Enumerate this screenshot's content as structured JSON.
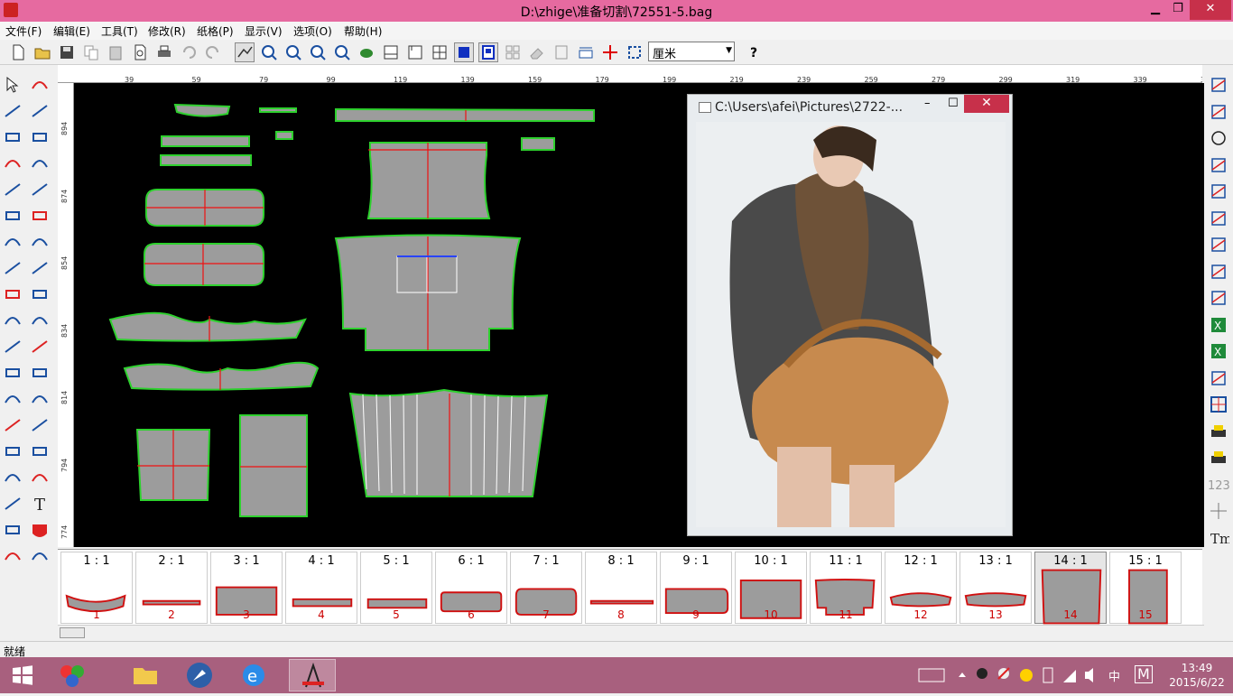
{
  "window": {
    "title": "D:\\zhige\\准备切割\\72551-5.bag",
    "min": "▁",
    "max": "❐",
    "close": "✕"
  },
  "menu": [
    "文件(F)",
    "编辑(E)",
    "工具(T)",
    "修改(R)",
    "纸格(P)",
    "显示(V)",
    "选项(O)",
    "帮助(H)"
  ],
  "toolbar": {
    "unit_value": "厘米"
  },
  "ruler": {
    "h_ticks": [
      "39",
      "59",
      "79",
      "99",
      "119",
      "139",
      "159",
      "179",
      "199",
      "219",
      "239",
      "259",
      "279",
      "299",
      "319",
      "339",
      "35"
    ],
    "v_ticks": [
      "894",
      "874",
      "854",
      "834",
      "814",
      "794",
      "774"
    ]
  },
  "photo_window": {
    "title": "C:\\Users\\afei\\Pictures\\2722-...",
    "min": "–",
    "max": "☐",
    "close": "✕"
  },
  "thumbnails": [
    {
      "scale": "1 : 1",
      "name": "1"
    },
    {
      "scale": "2 : 1",
      "name": "2"
    },
    {
      "scale": "3 : 1",
      "name": "3"
    },
    {
      "scale": "4 : 1",
      "name": "4"
    },
    {
      "scale": "5 : 1",
      "name": "5"
    },
    {
      "scale": "6 : 1",
      "name": "6"
    },
    {
      "scale": "7 : 1",
      "name": "7"
    },
    {
      "scale": "8 : 1",
      "name": "8"
    },
    {
      "scale": "9 : 1",
      "name": "9"
    },
    {
      "scale": "10 : 1",
      "name": "10"
    },
    {
      "scale": "11 : 1",
      "name": "11"
    },
    {
      "scale": "12 : 1",
      "name": "12"
    },
    {
      "scale": "13 : 1",
      "name": "13"
    },
    {
      "scale": "14 : 1",
      "name": "14"
    },
    {
      "scale": "15 : 1",
      "name": "15"
    }
  ],
  "status": {
    "text": "就绪"
  },
  "taskbar": {
    "time": "13:49",
    "date": "2015/6/22",
    "ime": "中",
    "ime2": "M"
  },
  "right_tool_text": {
    "nums": "123",
    "tm": "Tm"
  }
}
